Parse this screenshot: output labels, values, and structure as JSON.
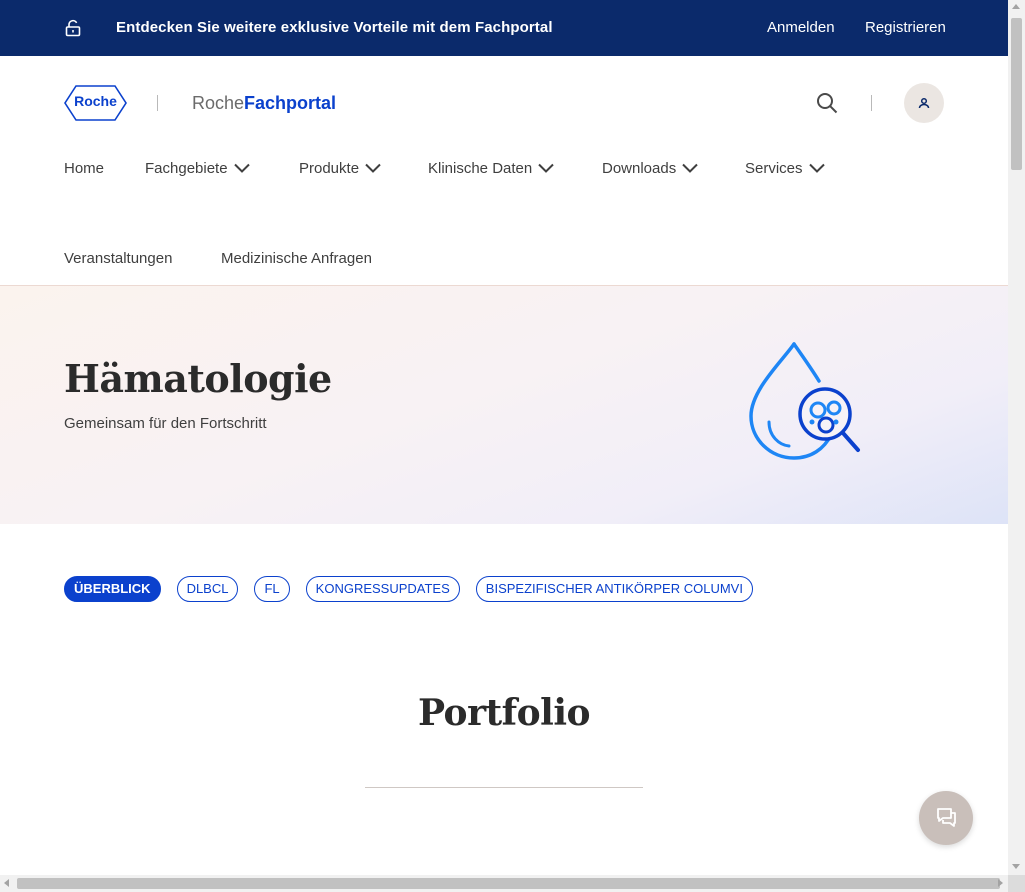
{
  "banner": {
    "promo_text": "Entdecken Sie weitere exklusive Vorteile mit dem Fachportal",
    "login_label": "Anmelden",
    "register_label": "Registrieren",
    "icon": "unlock-icon"
  },
  "header": {
    "logo_text": "Roche",
    "portal_name_part1": "Roche",
    "portal_name_part2": "Fachportal",
    "brand_color": "#0b41cd",
    "search_icon": "search-icon",
    "account_icon": "user-icon"
  },
  "nav": {
    "items": [
      {
        "label": "Home",
        "has_dropdown": false
      },
      {
        "label": "Fachgebiete",
        "has_dropdown": true
      },
      {
        "label": "Produkte",
        "has_dropdown": true
      },
      {
        "label": "Klinische Daten",
        "has_dropdown": true
      },
      {
        "label": "Downloads",
        "has_dropdown": true
      },
      {
        "label": "Services",
        "has_dropdown": true
      },
      {
        "label": "Veranstaltungen",
        "has_dropdown": false
      },
      {
        "label": "Medizinische Anfragen",
        "has_dropdown": false
      }
    ]
  },
  "hero": {
    "title": "Hämatologie",
    "subtitle": "Gemeinsam für den Fortschritt",
    "icon": "blood-drop-magnifier-icon"
  },
  "chips": {
    "items": [
      {
        "label": "ÜBERBLICK",
        "active": true
      },
      {
        "label": "DLBCL",
        "active": false
      },
      {
        "label": "FL",
        "active": false
      },
      {
        "label": "KONGRESSUPDATES",
        "active": false
      },
      {
        "label": "BISPEZIFISCHER ANTIKÖRPER COLUMVI",
        "active": false
      }
    ]
  },
  "section": {
    "title": "Portfolio"
  },
  "chat": {
    "icon": "chat-bubbles-icon"
  },
  "colors": {
    "banner_bg": "#0b2a6b",
    "accent": "#0b41cd",
    "chat_bg": "#c9bfba"
  }
}
